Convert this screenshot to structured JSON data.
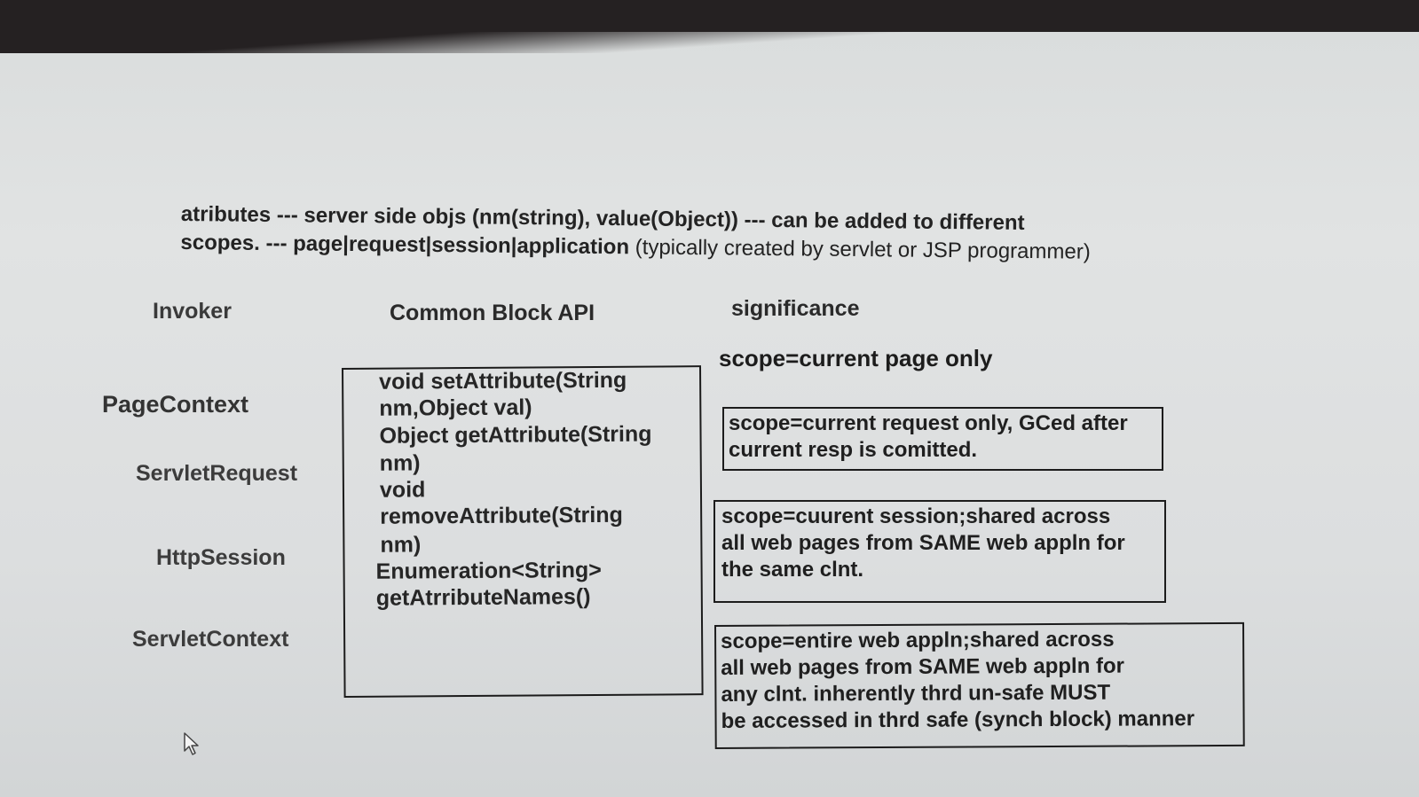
{
  "intro": {
    "line1": "atributes --- server side objs (nm(string), value(Object)) --- can be added to different",
    "line2": "scopes. --- page|request|session|application",
    "note": "(typically created by servlet or JSP programmer)"
  },
  "headers": {
    "invoker": "Invoker",
    "api": "Common Block API",
    "significance": "significance"
  },
  "invokers": [
    "PageContext",
    "ServletRequest",
    "HttpSession",
    "ServletContext"
  ],
  "api_lines": [
    "void setAttribute(String",
    "nm,Object val)",
    "Object getAttribute(String",
    "nm)",
    "void",
    "removeAttribute(String",
    "nm)",
    "Enumeration<String>",
    "getAtrributeNames()"
  ],
  "significance": {
    "page": "scope=current page only",
    "request": [
      "scope=current request only, GCed after",
      "current resp is comitted."
    ],
    "session": [
      "scope=cuurent session;shared across",
      "all web pages from SAME web appln for",
      "the same clnt."
    ],
    "application": [
      "scope=entire web appln;shared across",
      "all web pages from SAME web appln for",
      "any clnt. inherently thrd un-safe MUST",
      "be accessed in thrd safe (synch block) manner"
    ]
  },
  "icons": {
    "pointer": "mouse-pointer-icon"
  }
}
